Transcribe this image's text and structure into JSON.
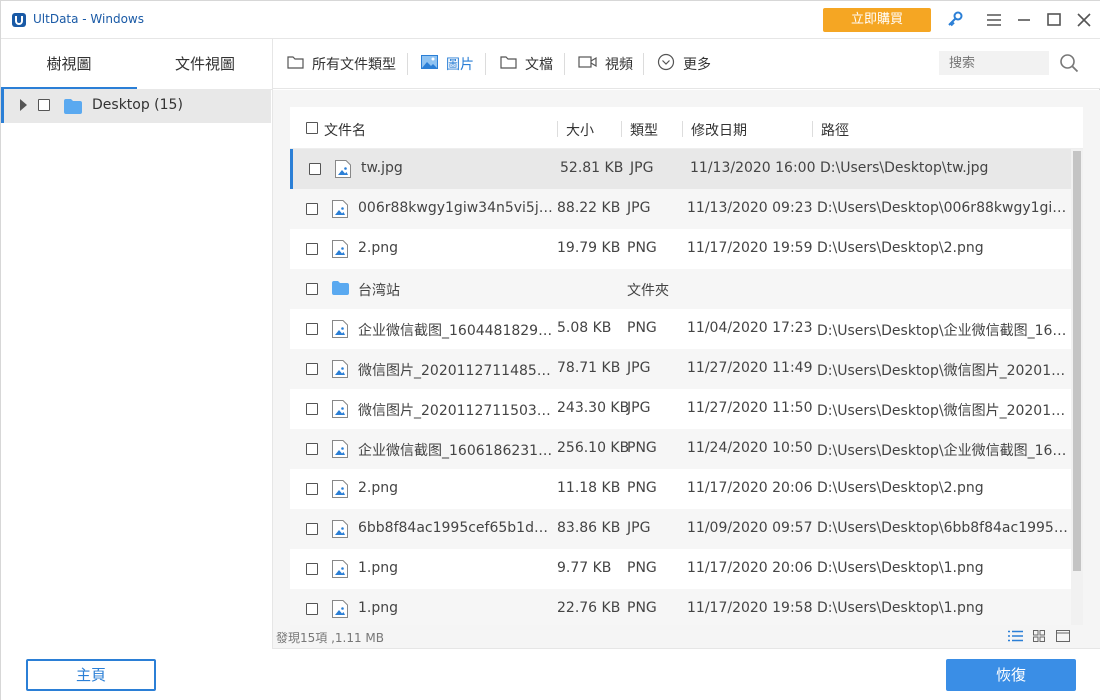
{
  "titlebar": {
    "title": "UltData - Windows",
    "buy_label": "立即購買",
    "icons": [
      "app-logo-icon",
      "key-icon",
      "menu-icon",
      "minimize-icon",
      "maximize-icon",
      "close-icon"
    ]
  },
  "left_panel": {
    "tabs": [
      {
        "label": "樹視圖",
        "active": true
      },
      {
        "label": "文件視圖",
        "active": false
      }
    ],
    "tree": [
      {
        "label": "Desktop (15)",
        "expanded": false,
        "checked": false,
        "selected": true
      }
    ]
  },
  "filters": [
    {
      "label": "所有文件類型",
      "icon": "folder-icon",
      "active": false
    },
    {
      "label": "圖片",
      "icon": "image-icon",
      "active": true
    },
    {
      "label": "文檔",
      "icon": "folder-icon",
      "active": false
    },
    {
      "label": "視頻",
      "icon": "video-icon",
      "active": false
    },
    {
      "label": "更多",
      "icon": "chevron-circle-icon",
      "active": false
    }
  ],
  "search": {
    "placeholder": "搜索"
  },
  "table": {
    "headers": {
      "name": "文件名",
      "size": "大小",
      "type": "類型",
      "date": "修改日期",
      "path": "路徑"
    },
    "rows": [
      {
        "name": "tw.jpg",
        "size": "52.81 KB",
        "type": "JPG",
        "date": "11/13/2020 16:00",
        "path": "D:\\Users\\Desktop\\tw.jpg",
        "icon": "image"
      },
      {
        "name": "006r88kwgy1giw34n5vi5j31...",
        "size": "88.22 KB",
        "type": "JPG",
        "date": "11/13/2020 09:23",
        "path": "D:\\Users\\Desktop\\006r88kwgy1giw3...",
        "icon": "image"
      },
      {
        "name": "2.png",
        "size": "19.79 KB",
        "type": "PNG",
        "date": "11/17/2020 19:59",
        "path": "D:\\Users\\Desktop\\2.png",
        "icon": "image"
      },
      {
        "name": "台湾站",
        "size": "",
        "type": "文件夾",
        "date": "",
        "path": "",
        "icon": "folder"
      },
      {
        "name": "企业微信截图_160448182984...",
        "size": "5.08 KB",
        "type": "PNG",
        "date": "11/04/2020 17:23",
        "path": "D:\\Users\\Desktop\\企业微信截图_160...",
        "icon": "image"
      },
      {
        "name": "微信图片_20201127114854.jpg",
        "size": "78.71 KB",
        "type": "JPG",
        "date": "11/27/2020 11:49",
        "path": "D:\\Users\\Desktop\\微信图片_2020112...",
        "icon": "image"
      },
      {
        "name": "微信图片_20201127115037.jpg",
        "size": "243.30 KB",
        "type": "JPG",
        "date": "11/27/2020 11:50",
        "path": "D:\\Users\\Desktop\\微信图片_2020112...",
        "icon": "image"
      },
      {
        "name": "企业微信截图_160618623177...",
        "size": "256.10 KB",
        "type": "PNG",
        "date": "11/24/2020 10:50",
        "path": "D:\\Users\\Desktop\\企业微信截图_160...",
        "icon": "image"
      },
      {
        "name": "2.png",
        "size": "11.18 KB",
        "type": "PNG",
        "date": "11/17/2020 20:06",
        "path": "D:\\Users\\Desktop\\2.png",
        "icon": "image"
      },
      {
        "name": "6bb8f84ac1995cef65b1d5d...",
        "size": "83.86 KB",
        "type": "JPG",
        "date": "11/09/2020 09:57",
        "path": "D:\\Users\\Desktop\\6bb8f84ac1995ce...",
        "icon": "image"
      },
      {
        "name": "1.png",
        "size": "9.77 KB",
        "type": "PNG",
        "date": "11/17/2020 20:06",
        "path": "D:\\Users\\Desktop\\1.png",
        "icon": "image"
      },
      {
        "name": "1.png",
        "size": "22.76 KB",
        "type": "PNG",
        "date": "11/17/2020 19:58",
        "path": "D:\\Users\\Desktop\\1.png",
        "icon": "image"
      }
    ]
  },
  "status": {
    "text": "發現15項 ,1.11 MB"
  },
  "footer": {
    "home_label": "主頁",
    "recover_label": "恢復"
  },
  "colors": {
    "accent": "#2b7fd6",
    "buy": "#f5a623",
    "recover": "#3a8ee6"
  }
}
